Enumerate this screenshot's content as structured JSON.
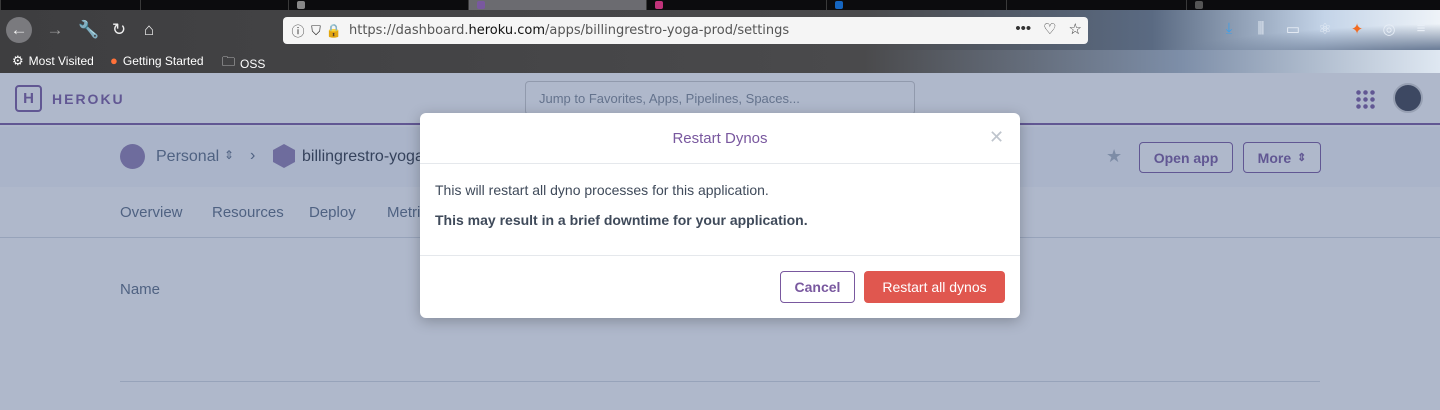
{
  "browser": {
    "url_prefix": "https://dashboard.",
    "url_domain": "heroku.com",
    "url_path": "/apps/billingrestro-yoga-prod/settings",
    "bookmarks": [
      {
        "label": "Most Visited",
        "icon": "gear-icon"
      },
      {
        "label": "Getting Started",
        "icon": "firefox-icon"
      },
      {
        "label": "OSS",
        "icon": "folder-icon"
      }
    ]
  },
  "header": {
    "brand": "HEROKU",
    "search_placeholder": "Jump to Favorites, Apps, Pipelines, Spaces..."
  },
  "breadcrumb": {
    "owner": "Personal",
    "app": "billingrestro-yoga"
  },
  "actions": {
    "open_app": "Open app",
    "more": "More"
  },
  "tabs": [
    "Overview",
    "Resources",
    "Deploy",
    "Metri"
  ],
  "content": {
    "name_label": "Name"
  },
  "modal": {
    "title": "Restart Dynos",
    "message": "This will restart all dyno processes for this application.",
    "warning": "This may result in a brief downtime for your application.",
    "cancel_label": "Cancel",
    "confirm_label": "Restart all dynos"
  },
  "colors": {
    "brand": "#79589f",
    "danger": "#e0574f",
    "overlay": "#405682"
  }
}
